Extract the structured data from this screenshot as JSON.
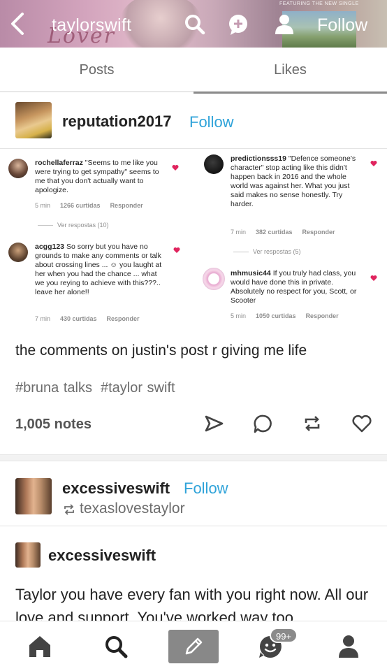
{
  "header": {
    "title": "taylorswift",
    "follow_label": "Follow",
    "banner_caption": "FEATURING THE NEW SINGLE",
    "banner_script": "Lover"
  },
  "tabs": [
    {
      "label": "Posts",
      "active": false
    },
    {
      "label": "Likes",
      "active": true
    }
  ],
  "post1": {
    "blog": "reputation2017",
    "follow_label": "Follow",
    "screenshot": {
      "left_column": [
        {
          "user": "rochellaferraz",
          "text": "\"Seems to me like you were trying to get sympathy\" seems to me that you don't actually want to apologize.",
          "time": "5 min",
          "likes": "1266 curtidas",
          "reply": "Responder",
          "replies_link": "Ver respostas (10)"
        },
        {
          "user": "acgg123",
          "text": "So sorry but you have  no grounds to make any comments or talk about crossing lines ... ☺ you laught at her when you had the chance ... what we you reying to achieve with this???.. leave her alone!!",
          "time": "7 min",
          "likes": "430 curtidas",
          "reply": "Responder"
        }
      ],
      "right_column": [
        {
          "user": "predictionsss19",
          "text": "\"Defence someone's character\" stop acting like this didn't happen back in 2016 and the whole world was against her. What you just said makes no sense honestly. Try harder.",
          "time": "7 min",
          "likes": "382 curtidas",
          "reply": "Responder",
          "replies_link": "Ver respostas (5)"
        },
        {
          "user": "mhmusic44",
          "text": "If you truly had class, you would have done this in private. Absolutely no respect for you, Scott, or Scooter",
          "time": "5 min",
          "likes": "1050 curtidas",
          "reply": "Responder"
        }
      ]
    },
    "text": "the comments on justin's post r giving me life",
    "tags": [
      "#bruna talks",
      "#taylor swift"
    ],
    "notes": "1,005 notes"
  },
  "post2": {
    "blog": "excessiveswift",
    "follow_label": "Follow",
    "reblogged_from": "texaslovestaylor",
    "inner_blog": "excessiveswift",
    "body": "Taylor you have every fan with you right now. All our love and support. You've worked way too"
  },
  "bottom_nav": {
    "badge": "99+"
  },
  "colors": {
    "accent": "#2fa3d9",
    "compose_bg": "#888888",
    "heart": "#e0245e"
  },
  "icons": [
    "back-arrow-icon",
    "search-icon",
    "chat-plus-icon",
    "person-add-icon",
    "send-icon",
    "reply-icon",
    "reblog-icon",
    "like-heart-icon",
    "home-icon",
    "pencil-icon",
    "activity-face-icon",
    "account-icon"
  ]
}
